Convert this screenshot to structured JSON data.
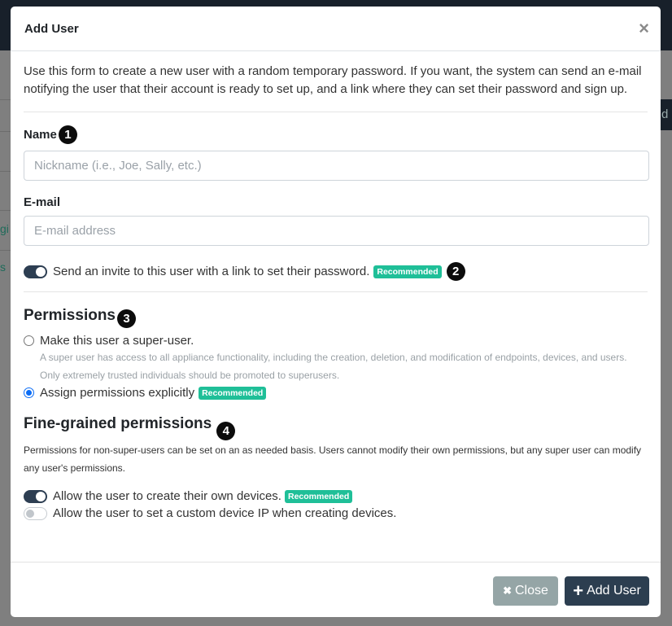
{
  "background": {
    "fragments": [
      "gi",
      "s",
      "d"
    ]
  },
  "modal": {
    "title": "Add User",
    "close_icon": "×",
    "intro": "Use this form to create a new user with a random temporary password. If you want, the system can send an e-mail notifying the user that their account is ready to set up, and a link where they can set their password and sign up.",
    "name": {
      "label": "Name",
      "placeholder": "Nickname (i.e., Joe, Sally, etc.)",
      "value": "",
      "marker": "1"
    },
    "email": {
      "label": "E-mail",
      "placeholder": "E-mail address",
      "value": ""
    },
    "invite": {
      "label": "Send an invite to this user with a link to set their password.",
      "enabled": true,
      "badge": "Recommended",
      "marker": "2"
    },
    "permissions": {
      "title": "Permissions",
      "marker": "3",
      "options": [
        {
          "label": "Make this user a super-user.",
          "checked": false,
          "help": [
            "A super user has access to all appliance functionality, including the creation, deletion, and modification of endpoints, devices, and users.",
            "Only extremely trusted individuals should be promoted to superusers."
          ]
        },
        {
          "label": "Assign permissions explicitly",
          "checked": true,
          "badge": "Recommended"
        }
      ]
    },
    "fine_grained": {
      "title": "Fine-grained permissions",
      "marker": "4",
      "description": "Permissions for non-super-users can be set on an as needed basis. Users cannot modify their own permissions, but any super user can modify any user's permissions.",
      "toggles": [
        {
          "label": "Allow the user to create their own devices.",
          "enabled": true,
          "badge": "Recommended"
        },
        {
          "label": "Allow the user to set a custom device IP when creating devices.",
          "enabled": false
        }
      ]
    },
    "footer": {
      "close_label": "Close",
      "close_icon": "✖",
      "add_label": "Add User",
      "add_icon": "+"
    }
  },
  "colors": {
    "accent_dark": "#2c3e50",
    "badge_green": "#1fbf98",
    "radio_blue": "#0b6cf5",
    "close_button": "#95a5a6"
  }
}
